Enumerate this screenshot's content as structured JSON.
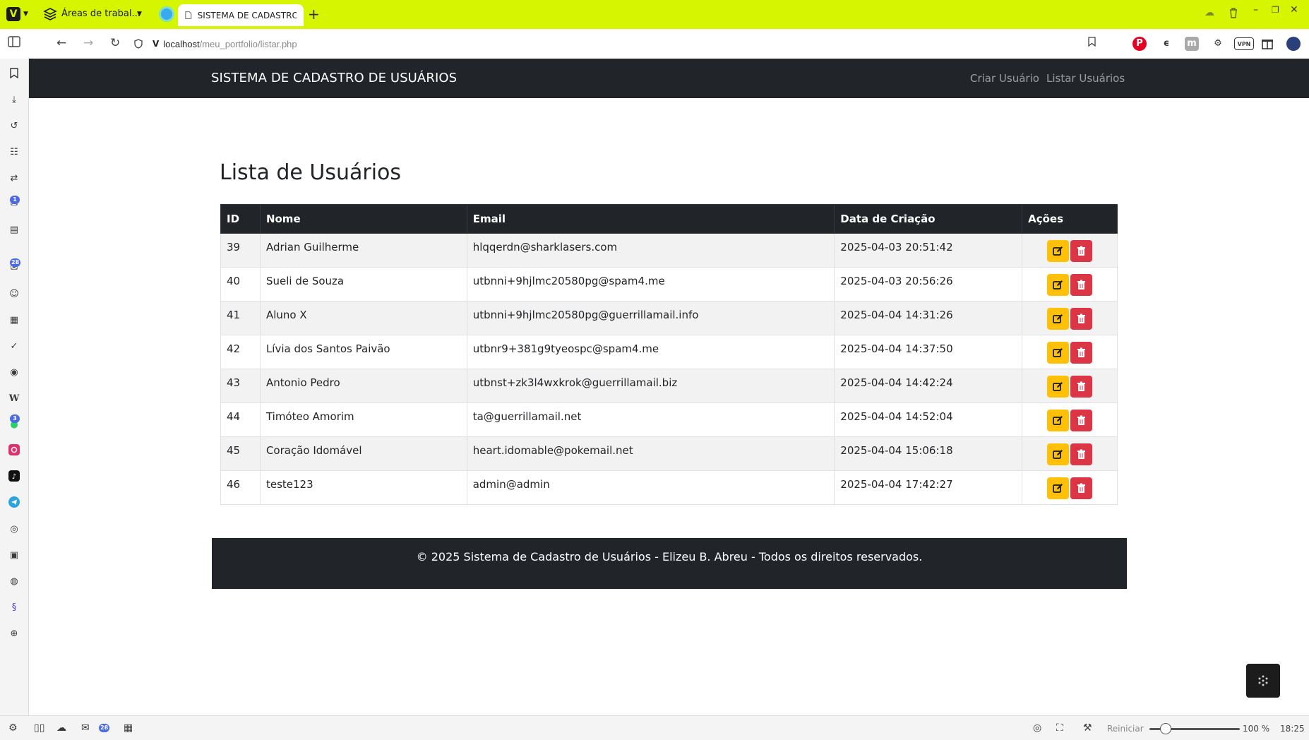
{
  "browser": {
    "workspace_label": "Áreas de trabal...",
    "active_tab_title": "SISTEMA DE CADASTRO DI",
    "new_tab": "+",
    "url_host": "localhost",
    "url_path": "/meu_portfolio/listar.php",
    "accent_color": "#d5f500",
    "side_badges": {
      "mail": "1",
      "feeds": "28",
      "whatsapp": "3"
    },
    "status": {
      "mail_badge": "28",
      "reset_label": "Reiniciar",
      "zoom_label": "100 %",
      "clock": "18:25"
    }
  },
  "site": {
    "brand": "SISTEMA DE CADASTRO DE USUÁRIOS",
    "nav": {
      "create_user": "Criar Usuário",
      "list_users": "Listar Usuários"
    },
    "heading": "Lista de Usuários",
    "table": {
      "headers": {
        "id": "ID",
        "name": "Nome",
        "email": "Email",
        "created": "Data de Criação",
        "actions": "Ações"
      },
      "rows": [
        {
          "id": "39",
          "name": "Adrian Guilherme",
          "email": "hlqqerdn@sharklasers.com",
          "created": "2025-04-03 20:51:42"
        },
        {
          "id": "40",
          "name": "Sueli de Souza",
          "email": "utbnni+9hjlmc20580pg@spam4.me",
          "created": "2025-04-03 20:56:26"
        },
        {
          "id": "41",
          "name": "Aluno X",
          "email": "utbnni+9hjlmc20580pg@guerrillamail.info",
          "created": "2025-04-04 14:31:26"
        },
        {
          "id": "42",
          "name": "Lívia dos Santos Paivão",
          "email": "utbnr9+381g9tyeospc@spam4.me",
          "created": "2025-04-04 14:37:50"
        },
        {
          "id": "43",
          "name": "Antonio Pedro",
          "email": "utbnst+zk3l4wxkrok@guerrillamail.biz",
          "created": "2025-04-04 14:42:24"
        },
        {
          "id": "44",
          "name": "Timóteo Amorim",
          "email": "ta@guerrillamail.net",
          "created": "2025-04-04 14:52:04"
        },
        {
          "id": "45",
          "name": "Coração Idomável",
          "email": "heart.idomable@pokemail.net",
          "created": "2025-04-04 15:06:18"
        },
        {
          "id": "46",
          "name": "teste123",
          "email": "admin@admin",
          "created": "2025-04-04 17:42:27"
        }
      ]
    },
    "footer": "© 2025 Sistema de Cadastro de Usuários - Elizeu B. Abreu - Todos os direitos reservados.",
    "colors": {
      "dark": "#212529",
      "edit_button": "#ffc107",
      "delete_button": "#dc3545"
    }
  }
}
